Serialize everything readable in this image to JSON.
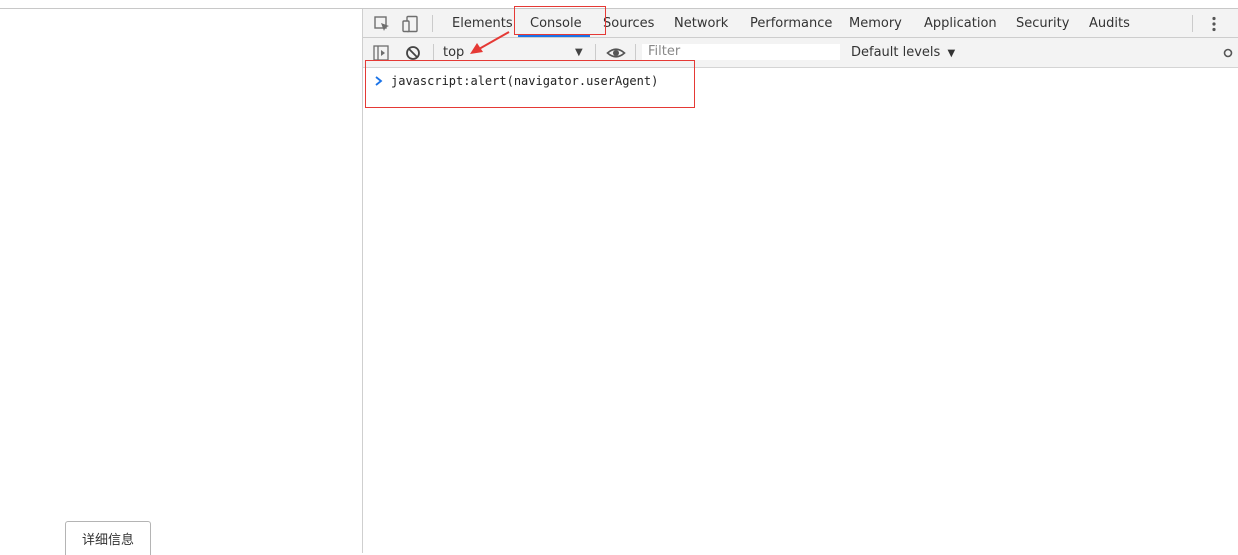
{
  "page": {
    "details_button": "详细信息"
  },
  "devtools": {
    "tabs": [
      {
        "label": "Elements"
      },
      {
        "label": "Console"
      },
      {
        "label": "Sources"
      },
      {
        "label": "Network"
      },
      {
        "label": "Performance"
      },
      {
        "label": "Memory"
      },
      {
        "label": "Application"
      },
      {
        "label": "Security"
      },
      {
        "label": "Audits"
      }
    ],
    "active_tab": "Console",
    "console_toolbar": {
      "context": "top",
      "filter_placeholder": "Filter",
      "levels": "Default levels"
    },
    "console": {
      "input": "javascript:alert(navigator.userAgent)"
    }
  },
  "colors": {
    "accent": "#1a73e8",
    "annotation": "#e53935"
  }
}
